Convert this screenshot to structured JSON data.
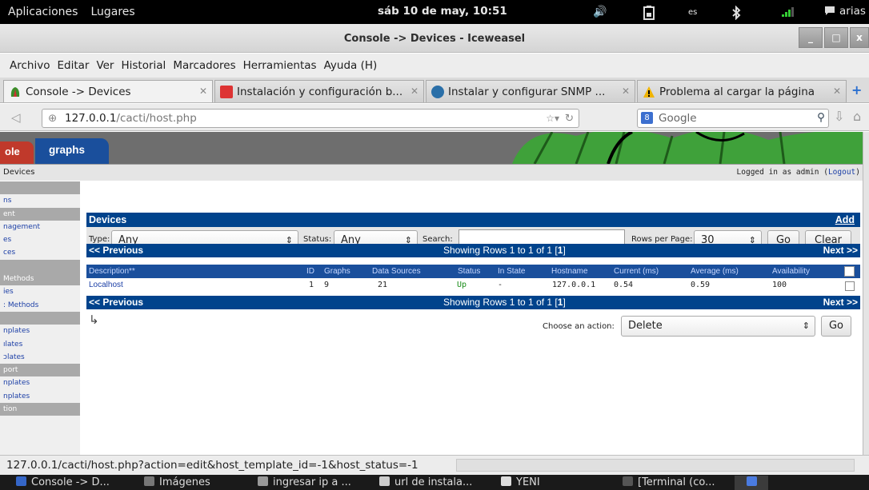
{
  "panel": {
    "apps": "Aplicaciones",
    "places": "Lugares",
    "clock": "sáb 10 de may, 10:51",
    "volume_icon": "🔊",
    "keyboard": "es",
    "user": "arias"
  },
  "window": {
    "title": "Console -> Devices - Iceweasel",
    "minimize": "_",
    "maximize": "□",
    "close": "x"
  },
  "menu": {
    "items": [
      "Archivo",
      "Editar",
      "Ver",
      "Historial",
      "Marcadores",
      "Herramientas",
      "Ayuda (H)"
    ]
  },
  "tabs": [
    {
      "label": "Console -> Devices"
    },
    {
      "label": "Instalación y configuración b..."
    },
    {
      "label": "Instalar y configurar SNMP ..."
    },
    {
      "label": "Problema al cargar la página"
    }
  ],
  "nav": {
    "url_host": "127.0.0.1",
    "url_path": "/cacti/host.php",
    "search_placeholder": "Google"
  },
  "cacti": {
    "tab_console_partial": "ole",
    "tab_graphs": "graphs",
    "breadcrumb": "Devices",
    "logged_in_prefix": "Logged in as admin (",
    "logout": "Logout",
    "logged_in_suffix": ")",
    "sidebar": [
      {
        "label": "",
        "header": true
      },
      {
        "label": "ns",
        "header": false
      },
      {
        "label": "ent",
        "header": true
      },
      {
        "label": "nagement",
        "header": false
      },
      {
        "label": "es",
        "header": false
      },
      {
        "label": "ces",
        "header": false
      },
      {
        "label": "",
        "header": true
      },
      {
        "label": " Methods",
        "header": true
      },
      {
        "label": "ies",
        "header": false
      },
      {
        "label": ": Methods",
        "header": false
      },
      {
        "label": "",
        "header": true
      },
      {
        "label": "nplates",
        "header": false
      },
      {
        "label": "ılates",
        "header": false
      },
      {
        "label": "ɔlates",
        "header": false
      },
      {
        "label": "port",
        "header": true
      },
      {
        "label": "nplates",
        "header": false
      },
      {
        "label": "nplates",
        "header": false
      },
      {
        "label": "tion",
        "header": true
      }
    ],
    "devices_title": "Devices",
    "add_label": "Add",
    "filter": {
      "type_label": "Type:",
      "type_value": "Any",
      "status_label": "Status:",
      "status_value": "Any",
      "search_label": "Search:",
      "search_value": "",
      "rows_label": "Rows per Page:",
      "rows_value": "30",
      "go": "Go",
      "clear": "Clear"
    },
    "pager": {
      "previous": "<< Previous",
      "showing": "Showing Rows 1 to 1 of 1 [",
      "page": "1",
      "showing_end": "]",
      "next": "Next >>"
    },
    "columns": [
      "Description**",
      "ID",
      "Graphs",
      "Data Sources",
      "Status",
      "In State",
      "Hostname",
      "Current (ms)",
      "Average (ms)",
      "Availability"
    ],
    "rows": [
      {
        "description": "Localhost",
        "id": "1",
        "graphs": "9",
        "data_sources": "21",
        "status": "Up",
        "in_state": "-",
        "hostname": "127.0.0.1",
        "current": "0.54",
        "average": "0.59",
        "availability": "100"
      }
    ],
    "action_label": "Choose an action:",
    "action_value": "Delete",
    "action_go": "Go"
  },
  "statusbar": {
    "url": "127.0.0.1/cacti/host.php?action=edit&host_template_id=-1&host_status=-1"
  },
  "taskbar": {
    "items": [
      "Console -> D...",
      "Imágenes",
      "ingresar ip a ...",
      "url de instala...",
      "YENI",
      "[Terminal (co..."
    ]
  },
  "colors": {
    "cacti_blue": "#00438c",
    "panel_black": "#000000",
    "status_up_green": "#198c19",
    "link_blue": "#1c3fa6"
  }
}
